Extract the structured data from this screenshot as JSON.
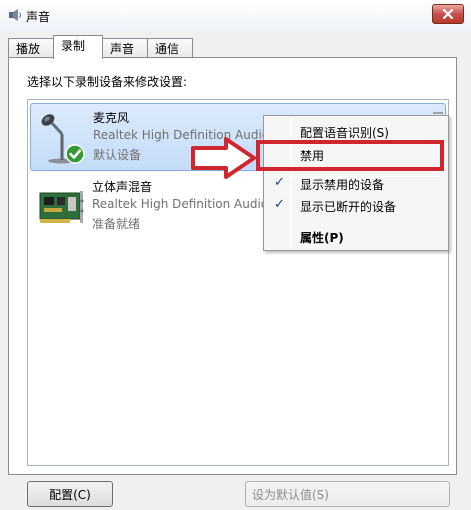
{
  "window": {
    "title": "声音"
  },
  "tabs": [
    {
      "label": "播放"
    },
    {
      "label": "录制"
    },
    {
      "label": "声音"
    },
    {
      "label": "通信"
    }
  ],
  "active_tab": "录制",
  "instruction": "选择以下录制设备来修改设置:",
  "devices": [
    {
      "name": "麦克风",
      "driver": "Realtek High Definition Audio",
      "status": "默认设备",
      "icon": "microphone-icon",
      "selected": true
    },
    {
      "name": "立体声混音",
      "driver": "Realtek High Definition Audio",
      "status": "准备就绪",
      "icon": "sound-card-icon",
      "selected": false
    }
  ],
  "context_menu": {
    "items": [
      {
        "label": "配置语音识别(S)",
        "checked": false,
        "bold": false
      },
      {
        "label": "禁用",
        "checked": false,
        "bold": false
      },
      {
        "label": "显示禁用的设备",
        "checked": true,
        "bold": false
      },
      {
        "label": "显示已断开的设备",
        "checked": true,
        "bold": false
      },
      {
        "label": "属性(P)",
        "checked": false,
        "bold": true
      }
    ],
    "check_glyph": "✓"
  },
  "buttons": {
    "configure": "配置(C)",
    "set_default": "设为默认值(S)"
  },
  "colors": {
    "highlight_red": "#d0262e",
    "selection_blue": "#c4dcf7"
  }
}
